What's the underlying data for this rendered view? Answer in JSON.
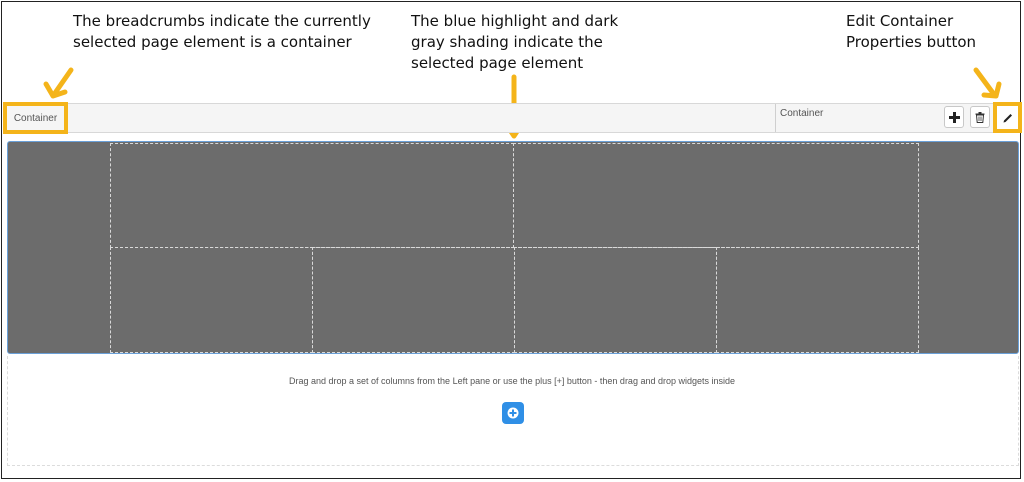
{
  "annotations": {
    "breadcrumbs": [
      "The breadcrumbs indicate the currently",
      "selected page element is a container"
    ],
    "highlight": [
      "The blue highlight and dark",
      "gray shading indicate the",
      "selected page element"
    ],
    "edit_button": [
      "Edit Container",
      "Properties button"
    ]
  },
  "toolbar": {
    "breadcrumb": "Container",
    "element_label": "Container",
    "add_icon": "plus-icon",
    "delete_icon": "trash-icon",
    "edit_icon": "pencil-icon"
  },
  "layout": {
    "top_row_columns": 2,
    "bottom_row_columns": 4
  },
  "drop_zone": {
    "hint": "Drag and drop a set of columns from the Left pane or use the plus [+] button - then drag and drop widgets inside",
    "add_icon": "plus-circle-icon"
  },
  "colors": {
    "callout": "#f4b41a",
    "selection_fill": "#6c6c6c",
    "selection_border": "#6aa0d8",
    "add_button": "#2f8fe6"
  }
}
